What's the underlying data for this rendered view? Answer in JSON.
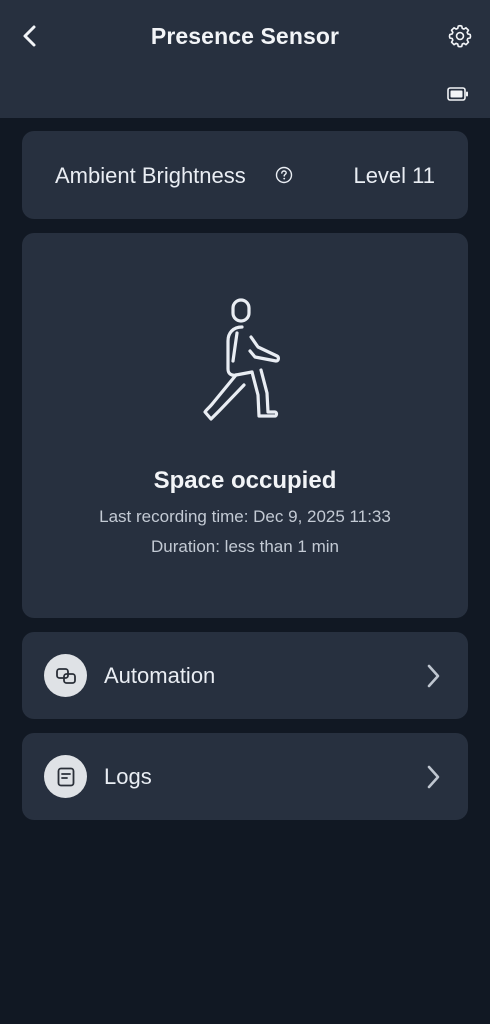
{
  "header": {
    "title": "Presence Sensor",
    "back_icon": "chevron-left-icon",
    "settings_icon": "gear-icon",
    "battery_icon": "battery-icon"
  },
  "brightness": {
    "label": "Ambient Brightness",
    "value": "Level 11",
    "help_icon": "question-circle-icon"
  },
  "status": {
    "icon": "walking-person-icon",
    "title": "Space occupied",
    "last_recording": "Last recording time: Dec 9, 2025 11:33",
    "duration": "Duration: less than 1 min"
  },
  "menu": [
    {
      "label": "Automation",
      "icon": "automation-icon"
    },
    {
      "label": "Logs",
      "icon": "log-document-icon"
    }
  ],
  "colors": {
    "background": "#111823",
    "card": "#27303f",
    "text": "#e9edf3",
    "subtext": "#c3cad4",
    "icon_circle": "#dfe2e6"
  }
}
